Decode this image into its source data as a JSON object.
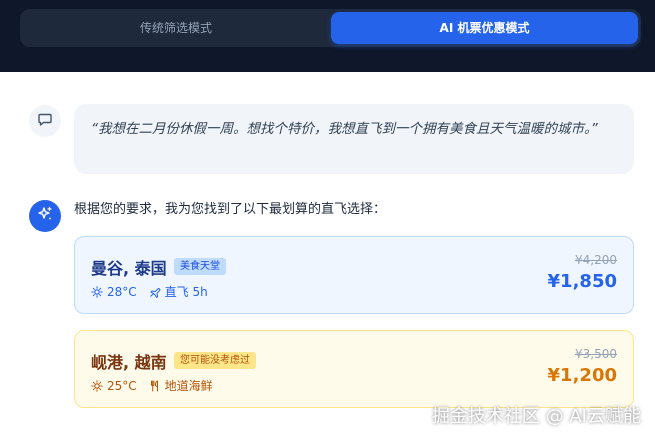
{
  "mode_switch": {
    "traditional_label": "传统筛选模式",
    "ai_label": "AI 机票优惠模式",
    "active": "ai"
  },
  "user_message": {
    "text": "“我想在二月份休假一周。想找个特价，我想直飞到一个拥有美食且天气温暖的城市。”",
    "icon": "chat-icon"
  },
  "ai_message": {
    "text": "根据您的要求，我为您找到了以下最划算的直飞选择：",
    "icon": "sparkle-icon"
  },
  "results": [
    {
      "city": "曼谷, 泰国",
      "tag": "美食天堂",
      "temperature": "28°C",
      "detail": "直飞 5h",
      "detail_icon": "plane-icon",
      "original_price": "¥4,200",
      "price": "¥1,850",
      "accent": "#2563eb"
    },
    {
      "city": "岘港, 越南",
      "tag": "您可能没考虑过",
      "temperature": "25°C",
      "detail": "地道海鲜",
      "detail_icon": "utensils-icon",
      "original_price": "¥3,500",
      "price": "¥1,200",
      "accent": "#d97706"
    }
  ],
  "watermark": "掘金技术社区 @ AI云赋能"
}
